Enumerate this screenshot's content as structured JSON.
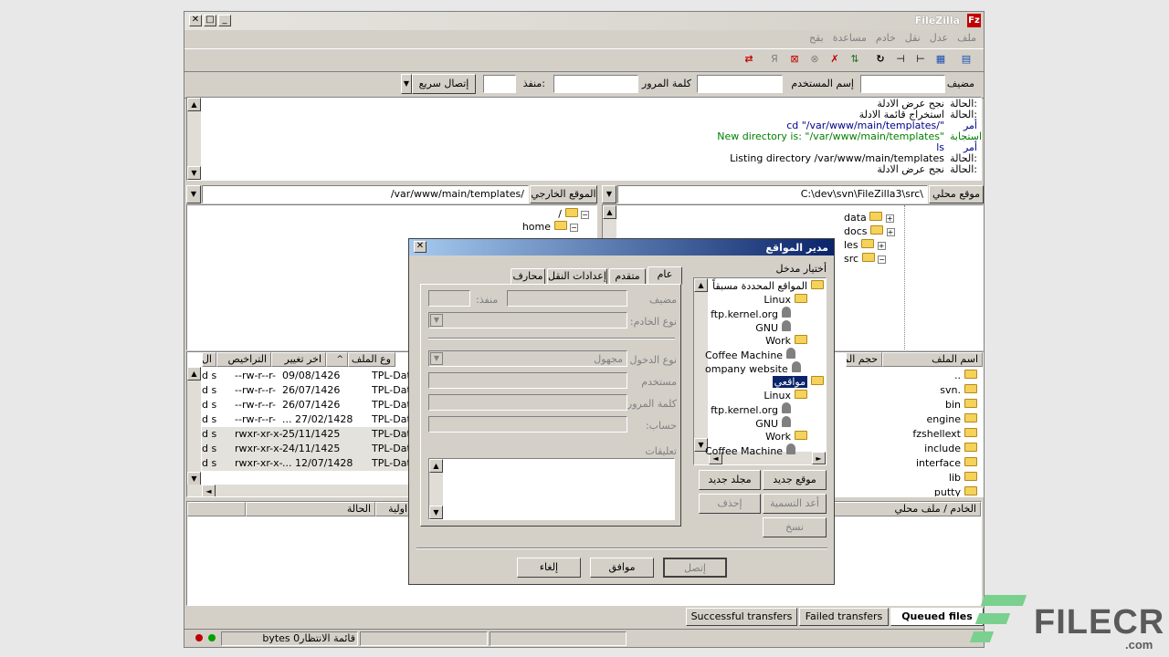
{
  "app": {
    "title": "FileZilla"
  },
  "menu": [
    "ملف",
    "عدل",
    "نقل",
    "خادم",
    "مساعدة",
    "بقح"
  ],
  "quickconnect": {
    "host_label": "مضيف",
    "user_label": "إسم المستخدم",
    "pass_label": "كلمة المرور",
    "port_label": "منفذ:",
    "connect_button": "إتصال سريع"
  },
  "log": [
    {
      "prefix": "الحالة:",
      "text": "نجح عرض الادلة",
      "color": "#000000"
    },
    {
      "prefix": "الحالة:",
      "text": "استخراج قائمة الادلة",
      "color": "#000000"
    },
    {
      "prefix": "أمر",
      "text": "cd \"/var/www/main/templates/\"",
      "color": "#00008b"
    },
    {
      "prefix": "استجابة",
      "text": "New directory is: \"/var/www/main/templates\"",
      "color": "#008000"
    },
    {
      "prefix": "أمر",
      "text": "ls",
      "color": "#00008b"
    },
    {
      "prefix": "الحالة:",
      "text": "Listing directory /var/www/main/templates",
      "color": "#000000"
    },
    {
      "prefix": "الحالة:",
      "text": "نجح عرض الادلة",
      "color": "#000000"
    }
  ],
  "local": {
    "label": "موقع محلي",
    "path": "C:\\dev\\svn\\FileZilla3\\src\\",
    "tree": [
      "data",
      "docs",
      "les",
      "src"
    ],
    "headers": {
      "name": "اسم الملف",
      "size": "حجم الم"
    },
    "files": [
      "..",
      "svn.",
      "bin",
      "engine",
      "fzshellext",
      "include",
      "interface",
      "lib",
      "putty"
    ]
  },
  "remote": {
    "label": "الموقع الخارجي",
    "path": "/var/www/main/templates/",
    "tree": [
      "/",
      "home"
    ],
    "headers": {
      "name": "وع الملف",
      "modified": "اخر تغيير",
      "perms": "التراخيص",
      "owner": "ال"
    },
    "files": [
      {
        "owner": "d s",
        "perms": "--rw-r--r-",
        "date": "09/08/1426",
        "type": "TPL-Date"
      },
      {
        "owner": "d s",
        "perms": "--rw-r--r-",
        "date": "26/07/1426",
        "type": "TPL-Date"
      },
      {
        "owner": "d s",
        "perms": "--rw-r--r-",
        "date": "26/07/1426",
        "type": "TPL-Date"
      },
      {
        "owner": "d s",
        "perms": "--rw-r--r-",
        "date": "... 27/02/1428",
        "type": "TPL-Date"
      },
      {
        "owner": "d s",
        "perms": "rwxr-xr-x-",
        "date": "25/11/1425",
        "type": "TPL-Date"
      },
      {
        "owner": "d s",
        "perms": "rwxr-xr-x-",
        "date": "24/11/1425",
        "type": "TPL-Date"
      },
      {
        "owner": "d s",
        "perms": "rwxr-xr-x-",
        "date": "... 12/07/1428",
        "type": "TPL-Date"
      }
    ]
  },
  "queue": {
    "headers": {
      "server": "الخادم / ملف محلي",
      "priority": "اولية",
      "status": "الحالة"
    },
    "tabs": [
      "Successful transfers",
      "Failed transfers",
      "Queued files"
    ]
  },
  "statusbar": {
    "text": "bytes 0قائمة الانتظار"
  },
  "site_manager": {
    "title": "مدير المواقع",
    "select_label": "أختيار مدخل",
    "tree": [
      {
        "label": "المواقع المحددة مسبقاً",
        "kind": "folder"
      },
      {
        "label": "Linux",
        "kind": "folder"
      },
      {
        "label": "ftp.kernel.org",
        "kind": "site"
      },
      {
        "label": "GNU",
        "kind": "site"
      },
      {
        "label": "Work",
        "kind": "folder"
      },
      {
        "label": "Coffee Machine",
        "kind": "site"
      },
      {
        "label": "ompany website",
        "kind": "site"
      },
      {
        "label": "مواقعي",
        "kind": "folder"
      },
      {
        "label": "Linux",
        "kind": "folder"
      },
      {
        "label": "ftp.kernel.org",
        "kind": "site"
      },
      {
        "label": "GNU",
        "kind": "site"
      },
      {
        "label": "Work",
        "kind": "folder"
      },
      {
        "label": "Coffee Machine",
        "kind": "site"
      }
    ],
    "tabs": [
      "عام",
      "متقدم",
      "إعدادات النقل",
      "محارف"
    ],
    "fields": {
      "host": "مضيف",
      "port": "منفذ:",
      "server_type": "نوع الخادم:",
      "logon_type": "نوع الدخول",
      "logon_value": "مجهول",
      "user": "مستخدم",
      "password": "كلمة المرور",
      "account": "حساب:",
      "comments": "تعليقات"
    },
    "buttons": {
      "new_site": "موقع جديد",
      "new_folder": "مجلد جديد",
      "rename": "أعد التسمية",
      "delete": "إحذف",
      "copy": "نسخ",
      "connect": "إتصل",
      "ok": "موافق",
      "cancel": "إلغاء"
    }
  },
  "watermark": {
    "brand": "FILECR",
    "domain": ".com"
  }
}
